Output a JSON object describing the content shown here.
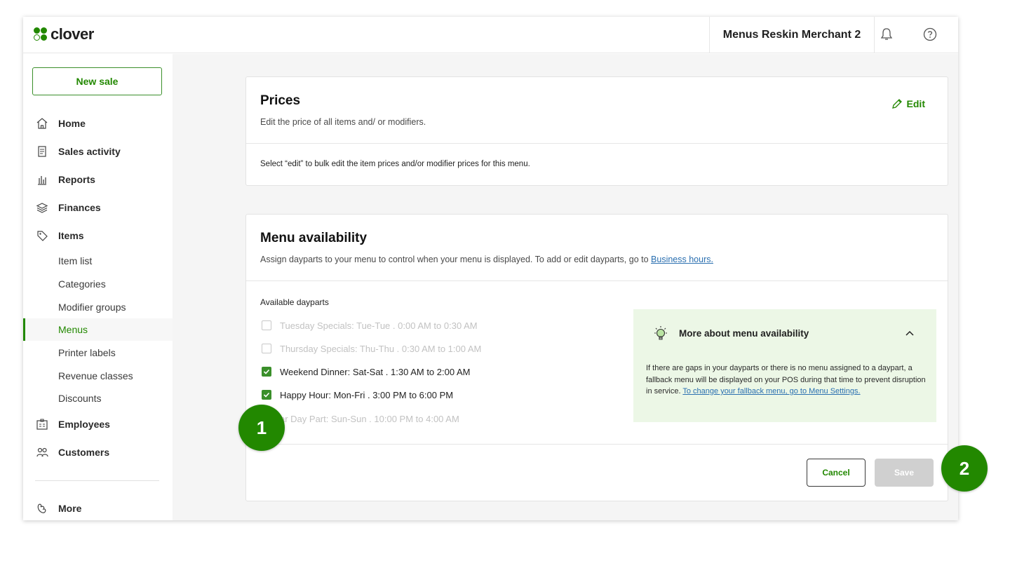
{
  "app": {
    "logo_text": "clover",
    "merchant_name": "Menus Reskin Merchant 2"
  },
  "sidebar": {
    "new_sale_label": "New sale",
    "items": [
      {
        "label": "Home",
        "icon": "home-icon"
      },
      {
        "label": "Sales activity",
        "icon": "receipt-icon"
      },
      {
        "label": "Reports",
        "icon": "bar-chart-icon"
      },
      {
        "label": "Finances",
        "icon": "layers-icon"
      },
      {
        "label": "Items",
        "icon": "tag-icon"
      }
    ],
    "sub_items": [
      {
        "label": "Item list"
      },
      {
        "label": "Categories"
      },
      {
        "label": "Modifier groups"
      },
      {
        "label": "Menus",
        "active": true
      },
      {
        "label": "Printer labels"
      },
      {
        "label": "Revenue classes"
      },
      {
        "label": "Discounts"
      }
    ],
    "items_after": [
      {
        "label": "Employees",
        "icon": "id-badge-icon"
      },
      {
        "label": "Customers",
        "icon": "people-icon"
      }
    ],
    "more_label": "More"
  },
  "prices": {
    "title": "Prices",
    "subtitle": "Edit the price of all items and/ or modifiers.",
    "edit_label": "Edit",
    "note": "Select “edit” to bulk edit the item prices and/or modifier prices for this menu."
  },
  "availability": {
    "title": "Menu availability",
    "subtitle_prefix": "Assign dayparts to your menu to control when your menu is displayed. To add or edit dayparts, go to ",
    "subtitle_link": "Business hours.",
    "dayparts_label": "Available dayparts",
    "dayparts": [
      {
        "label": "Tuesday Specials: Tue-Tue . 0:00 AM to 0:30 AM",
        "checked": false,
        "enabled": false
      },
      {
        "label": "Thursday Specials: Thu-Thu . 0:30 AM to 1:00 AM",
        "checked": false,
        "enabled": false
      },
      {
        "label": "Weekend Dinner: Sat-Sat . 1:30 AM to 2:00 AM",
        "checked": true,
        "enabled": true
      },
      {
        "label": "Happy Hour: Mon-Fri . 3:00 PM to 6:00 PM",
        "checked": true,
        "enabled": true
      },
      {
        "label": "ar Day Part: Sun-Sun . 10:00 PM to 4:00 AM",
        "checked": false,
        "enabled": false
      }
    ],
    "info": {
      "title": "More about menu availability",
      "body": "If there are gaps in your dayparts or there is no menu assigned to a daypart, a fallback menu will be displayed on your POS during that time to prevent disruption in service. ",
      "link": "To change your fallback menu, go to Menu Settings."
    },
    "cancel_label": "Cancel",
    "save_label": "Save"
  },
  "markers": {
    "step1": "1",
    "step2": "2"
  },
  "colors": {
    "brand_green": "#228800",
    "info_bg": "#ecf7e6",
    "link_blue": "#2a6fb0",
    "disabled_button": "#d0d0d0"
  }
}
